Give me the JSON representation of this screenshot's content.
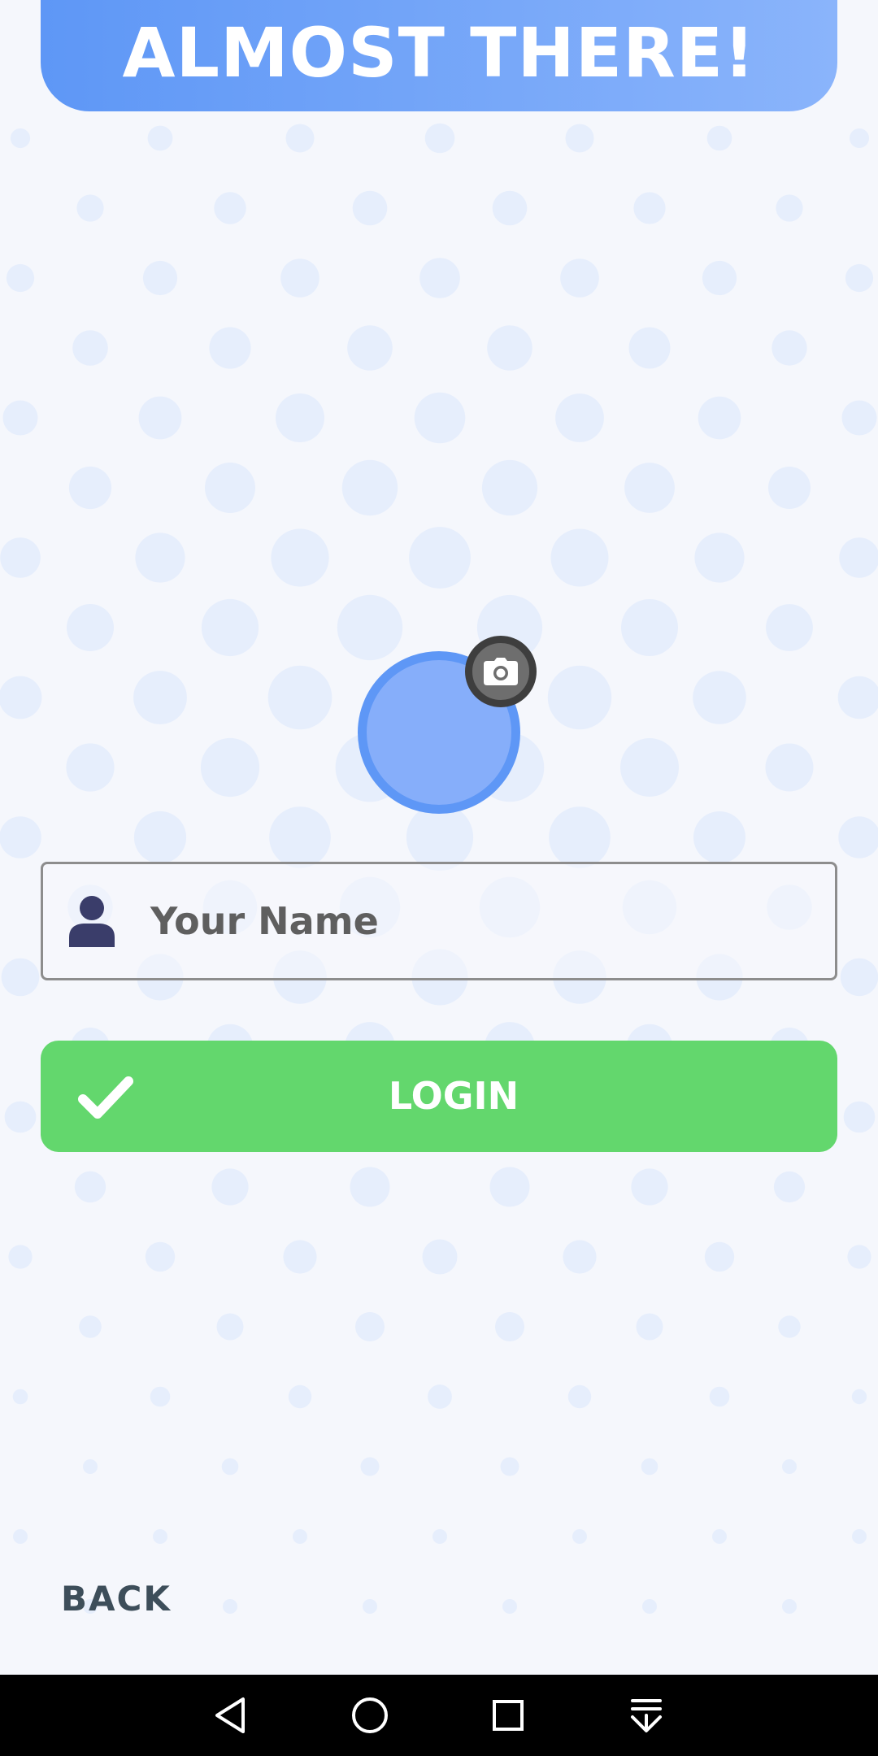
{
  "header": {
    "title": "ALMOST THERE!"
  },
  "avatar": {
    "camera_icon": "camera-icon"
  },
  "name_input": {
    "placeholder": "Your Name",
    "value": "",
    "icon": "person-icon"
  },
  "login_button": {
    "label": "LOGIN",
    "icon": "checkmark-icon"
  },
  "back_link": {
    "label": "BACK"
  },
  "system_nav": {
    "buttons": [
      "back-triangle-icon",
      "home-circle-icon",
      "recents-square-icon",
      "notifications-pull-down-icon"
    ]
  },
  "colors": {
    "background": "#f5f7fc",
    "dots": "#e6eefc",
    "header_gradient_start": "#5e97f6",
    "header_gradient_end": "#8ab4fb",
    "avatar_fill": "#86aefa",
    "avatar_ring": "#5e97f6",
    "login_green": "#63d76d",
    "back_text": "#3d4e5a",
    "person_icon": "#3a3d6a"
  }
}
